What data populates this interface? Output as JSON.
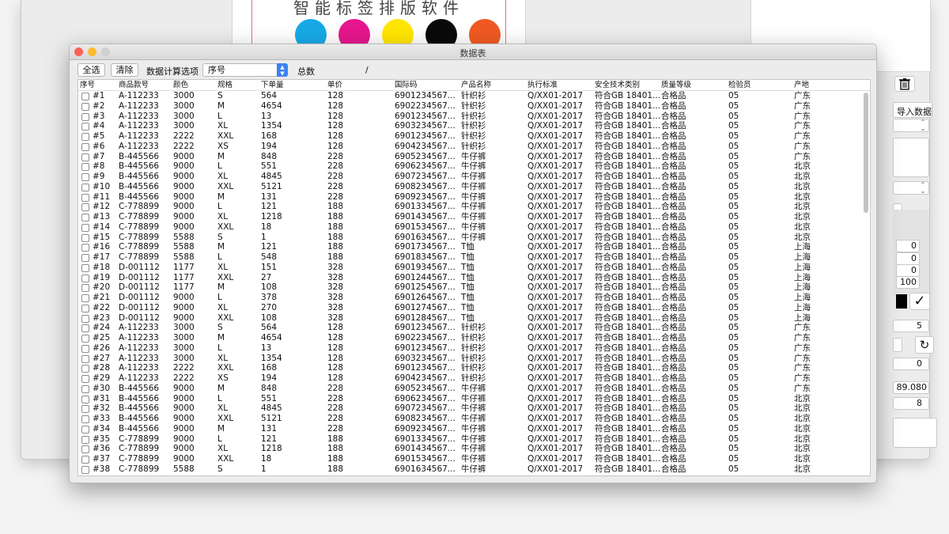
{
  "background": {
    "canvas_title": "智能标签排版软件",
    "cmyk_colors": [
      "#17a9e6",
      "#e6168c",
      "#ffe600",
      "#0a0a0a",
      "#f05a22"
    ],
    "right_panel": {
      "import_button": "导入数据",
      "trash_icon": "trash-icon",
      "field_values": [
        "0",
        "0",
        "0",
        "100"
      ],
      "value_5": "5",
      "value_0": "0",
      "value_8908": "89.080",
      "value_8": "8",
      "checkmark": "✓",
      "refresh_icon": "refresh-icon"
    }
  },
  "window": {
    "title": "数据表",
    "traffic_light_colors": [
      "#fc5f57",
      "#fdbc2e",
      "#d0d0d0"
    ]
  },
  "toolbar": {
    "select_all_label": "全选",
    "clear_label": "清除",
    "calc_option_label": "数据计算选项",
    "calc_option_value": "序号",
    "total_label": "总数",
    "total_separator": "/"
  },
  "table": {
    "columns": [
      "序号",
      "商品款号",
      "颜色",
      "规格",
      "下单量",
      "单价",
      "国际码",
      "产品名称",
      "执行标准",
      "安全技术类别",
      "质量等级",
      "检验员",
      "产地"
    ],
    "rows": [
      [
        "#1",
        "A-112233",
        "3000",
        "S",
        "564",
        "128",
        "6901234567...",
        "针织衫",
        "Q/XX01-2017",
        "符合GB 18401...",
        "合格品",
        "05",
        "广东"
      ],
      [
        "#2",
        "A-112233",
        "3000",
        "M",
        "4654",
        "128",
        "6902234567...",
        "针织衫",
        "Q/XX01-2017",
        "符合GB 18401...",
        "合格品",
        "05",
        "广东"
      ],
      [
        "#3",
        "A-112233",
        "3000",
        "L",
        "13",
        "128",
        "6901234567...",
        "针织衫",
        "Q/XX01-2017",
        "符合GB 18401...",
        "合格品",
        "05",
        "广东"
      ],
      [
        "#4",
        "A-112233",
        "3000",
        "XL",
        "1354",
        "128",
        "6903234567...",
        "针织衫",
        "Q/XX01-2017",
        "符合GB 18401...",
        "合格品",
        "05",
        "广东"
      ],
      [
        "#5",
        "A-112233",
        "2222",
        "XXL",
        "168",
        "128",
        "6901234567...",
        "针织衫",
        "Q/XX01-2017",
        "符合GB 18401...",
        "合格品",
        "05",
        "广东"
      ],
      [
        "#6",
        "A-112233",
        "2222",
        "XS",
        "194",
        "128",
        "6904234567...",
        "针织衫",
        "Q/XX01-2017",
        "符合GB 18401...",
        "合格品",
        "05",
        "广东"
      ],
      [
        "#7",
        "B-445566",
        "9000",
        "M",
        "848",
        "228",
        "6905234567...",
        "牛仔裤",
        "Q/XX01-2017",
        "符合GB 18401...",
        "合格品",
        "05",
        "广东"
      ],
      [
        "#8",
        "B-445566",
        "9000",
        "L",
        "551",
        "228",
        "6906234567...",
        "牛仔裤",
        "Q/XX01-2017",
        "符合GB 18401...",
        "合格品",
        "05",
        "北京"
      ],
      [
        "#9",
        "B-445566",
        "9000",
        "XL",
        "4845",
        "228",
        "6907234567...",
        "牛仔裤",
        "Q/XX01-2017",
        "符合GB 18401...",
        "合格品",
        "05",
        "北京"
      ],
      [
        "#10",
        "B-445566",
        "9000",
        "XXL",
        "5121",
        "228",
        "6908234567...",
        "牛仔裤",
        "Q/XX01-2017",
        "符合GB 18401...",
        "合格品",
        "05",
        "北京"
      ],
      [
        "#11",
        "B-445566",
        "9000",
        "M",
        "131",
        "228",
        "6909234567...",
        "牛仔裤",
        "Q/XX01-2017",
        "符合GB 18401...",
        "合格品",
        "05",
        "北京"
      ],
      [
        "#12",
        "C-778899",
        "9000",
        "L",
        "121",
        "188",
        "6901334567...",
        "牛仔裤",
        "Q/XX01-2017",
        "符合GB 18401...",
        "合格品",
        "05",
        "北京"
      ],
      [
        "#13",
        "C-778899",
        "9000",
        "XL",
        "1218",
        "188",
        "6901434567...",
        "牛仔裤",
        "Q/XX01-2017",
        "符合GB 18401...",
        "合格品",
        "05",
        "北京"
      ],
      [
        "#14",
        "C-778899",
        "9000",
        "XXL",
        "18",
        "188",
        "6901534567...",
        "牛仔裤",
        "Q/XX01-2017",
        "符合GB 18401...",
        "合格品",
        "05",
        "北京"
      ],
      [
        "#15",
        "C-778899",
        "5588",
        "S",
        "1",
        "188",
        "6901634567...",
        "牛仔裤",
        "Q/XX01-2017",
        "符合GB 18401...",
        "合格品",
        "05",
        "北京"
      ],
      [
        "#16",
        "C-778899",
        "5588",
        "M",
        "121",
        "188",
        "6901734567...",
        "T恤",
        "Q/XX01-2017",
        "符合GB 18401...",
        "合格品",
        "05",
        "上海"
      ],
      [
        "#17",
        "C-778899",
        "5588",
        "L",
        "548",
        "188",
        "6901834567...",
        "T恤",
        "Q/XX01-2017",
        "符合GB 18401...",
        "合格品",
        "05",
        "上海"
      ],
      [
        "#18",
        "D-001112",
        "1177",
        "XL",
        "151",
        "328",
        "6901934567...",
        "T恤",
        "Q/XX01-2017",
        "符合GB 18401...",
        "合格品",
        "05",
        "上海"
      ],
      [
        "#19",
        "D-001112",
        "1177",
        "XXL",
        "27",
        "328",
        "6901244567...",
        "T恤",
        "Q/XX01-2017",
        "符合GB 18401...",
        "合格品",
        "05",
        "上海"
      ],
      [
        "#20",
        "D-001112",
        "1177",
        "M",
        "108",
        "328",
        "6901254567...",
        "T恤",
        "Q/XX01-2017",
        "符合GB 18401...",
        "合格品",
        "05",
        "上海"
      ],
      [
        "#21",
        "D-001112",
        "9000",
        "L",
        "378",
        "328",
        "6901264567...",
        "T恤",
        "Q/XX01-2017",
        "符合GB 18401...",
        "合格品",
        "05",
        "上海"
      ],
      [
        "#22",
        "D-001112",
        "9000",
        "XL",
        "270",
        "328",
        "6901274567...",
        "T恤",
        "Q/XX01-2017",
        "符合GB 18401...",
        "合格品",
        "05",
        "上海"
      ],
      [
        "#23",
        "D-001112",
        "9000",
        "XXL",
        "108",
        "328",
        "6901284567...",
        "T恤",
        "Q/XX01-2017",
        "符合GB 18401...",
        "合格品",
        "05",
        "上海"
      ],
      [
        "#24",
        "A-112233",
        "3000",
        "S",
        "564",
        "128",
        "6901234567...",
        "针织衫",
        "Q/XX01-2017",
        "符合GB 18401...",
        "合格品",
        "05",
        "广东"
      ],
      [
        "#25",
        "A-112233",
        "3000",
        "M",
        "4654",
        "128",
        "6902234567...",
        "针织衫",
        "Q/XX01-2017",
        "符合GB 18401...",
        "合格品",
        "05",
        "广东"
      ],
      [
        "#26",
        "A-112233",
        "3000",
        "L",
        "13",
        "128",
        "6901234567...",
        "针织衫",
        "Q/XX01-2017",
        "符合GB 18401...",
        "合格品",
        "05",
        "广东"
      ],
      [
        "#27",
        "A-112233",
        "3000",
        "XL",
        "1354",
        "128",
        "6903234567...",
        "针织衫",
        "Q/XX01-2017",
        "符合GB 18401...",
        "合格品",
        "05",
        "广东"
      ],
      [
        "#28",
        "A-112233",
        "2222",
        "XXL",
        "168",
        "128",
        "6901234567...",
        "针织衫",
        "Q/XX01-2017",
        "符合GB 18401...",
        "合格品",
        "05",
        "广东"
      ],
      [
        "#29",
        "A-112233",
        "2222",
        "XS",
        "194",
        "128",
        "6904234567...",
        "针织衫",
        "Q/XX01-2017",
        "符合GB 18401...",
        "合格品",
        "05",
        "广东"
      ],
      [
        "#30",
        "B-445566",
        "9000",
        "M",
        "848",
        "228",
        "6905234567...",
        "牛仔裤",
        "Q/XX01-2017",
        "符合GB 18401...",
        "合格品",
        "05",
        "广东"
      ],
      [
        "#31",
        "B-445566",
        "9000",
        "L",
        "551",
        "228",
        "6906234567...",
        "牛仔裤",
        "Q/XX01-2017",
        "符合GB 18401...",
        "合格品",
        "05",
        "北京"
      ],
      [
        "#32",
        "B-445566",
        "9000",
        "XL",
        "4845",
        "228",
        "6907234567...",
        "牛仔裤",
        "Q/XX01-2017",
        "符合GB 18401...",
        "合格品",
        "05",
        "北京"
      ],
      [
        "#33",
        "B-445566",
        "9000",
        "XXL",
        "5121",
        "228",
        "6908234567...",
        "牛仔裤",
        "Q/XX01-2017",
        "符合GB 18401...",
        "合格品",
        "05",
        "北京"
      ],
      [
        "#34",
        "B-445566",
        "9000",
        "M",
        "131",
        "228",
        "6909234567...",
        "牛仔裤",
        "Q/XX01-2017",
        "符合GB 18401...",
        "合格品",
        "05",
        "北京"
      ],
      [
        "#35",
        "C-778899",
        "9000",
        "L",
        "121",
        "188",
        "6901334567...",
        "牛仔裤",
        "Q/XX01-2017",
        "符合GB 18401...",
        "合格品",
        "05",
        "北京"
      ],
      [
        "#36",
        "C-778899",
        "9000",
        "XL",
        "1218",
        "188",
        "6901434567...",
        "牛仔裤",
        "Q/XX01-2017",
        "符合GB 18401...",
        "合格品",
        "05",
        "北京"
      ],
      [
        "#37",
        "C-778899",
        "9000",
        "XXL",
        "18",
        "188",
        "6901534567...",
        "牛仔裤",
        "Q/XX01-2017",
        "符合GB 18401...",
        "合格品",
        "05",
        "北京"
      ],
      [
        "#38",
        "C-778899",
        "5588",
        "S",
        "1",
        "188",
        "6901634567...",
        "牛仔裤",
        "Q/XX01-2017",
        "符合GB 18401...",
        "合格品",
        "05",
        "北京"
      ]
    ]
  }
}
